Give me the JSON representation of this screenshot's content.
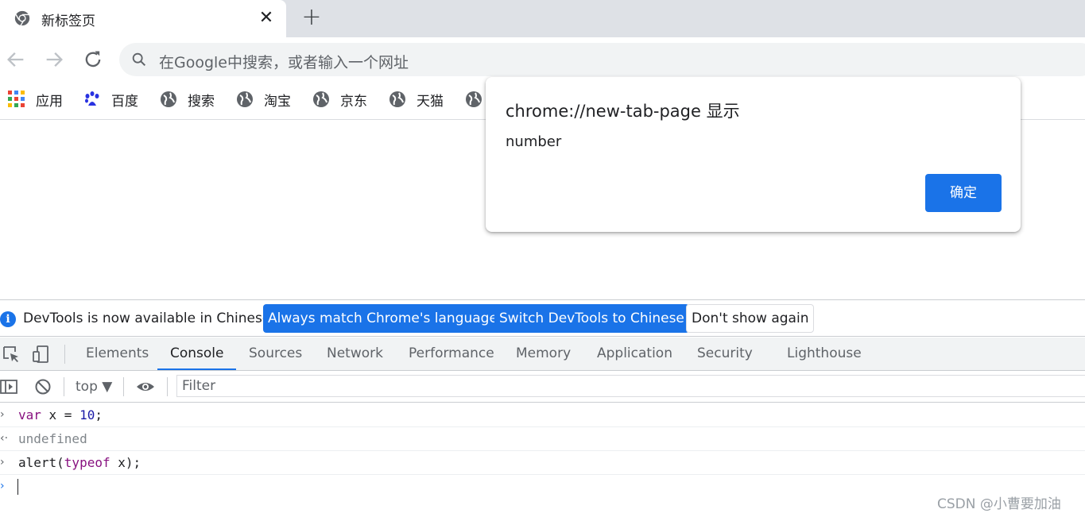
{
  "browser": {
    "tab_title": "新标签页",
    "tab_close": "✕",
    "new_tab": "+",
    "omnibox_placeholder": "在Google中搜索，或者输入一个网址"
  },
  "bookmarks": [
    {
      "label": "应用",
      "icon": "apps-grid-icon"
    },
    {
      "label": "百度",
      "icon": "baidu-paw-icon"
    },
    {
      "label": "搜索",
      "icon": "globe-icon"
    },
    {
      "label": "淘宝",
      "icon": "globe-icon"
    },
    {
      "label": "京东",
      "icon": "globe-icon"
    },
    {
      "label": "天猫",
      "icon": "globe-icon"
    }
  ],
  "dialog": {
    "title": "chrome://new-tab-page 显示",
    "message": "number",
    "ok_label": "确定"
  },
  "devtools": {
    "infobar": {
      "text": "DevTools is now available in Chinese!",
      "btn_match": "Always match Chrome's language",
      "btn_switch": "Switch DevTools to Chinese",
      "btn_dismiss": "Don't show again"
    },
    "tabs": [
      "Elements",
      "Console",
      "Sources",
      "Network",
      "Performance",
      "Memory",
      "Application",
      "Security",
      "Lighthouse"
    ],
    "active_tab": "Console",
    "context": "top ▼",
    "filter_placeholder": "Filter",
    "console": [
      {
        "type": "input",
        "prompt": "›",
        "kw": "var",
        "rest1": " x = ",
        "num": "10",
        "rest2": ";"
      },
      {
        "type": "output",
        "prompt": "‹·",
        "text": "undefined"
      },
      {
        "type": "input",
        "prompt": "›",
        "pre": "alert(",
        "kw": "typeof",
        "post": " x);"
      }
    ]
  },
  "watermark": "CSDN @小曹要加油",
  "colors": {
    "accent": "#1a73e8",
    "keyword": "#881280",
    "number": "#1a1aa6"
  }
}
